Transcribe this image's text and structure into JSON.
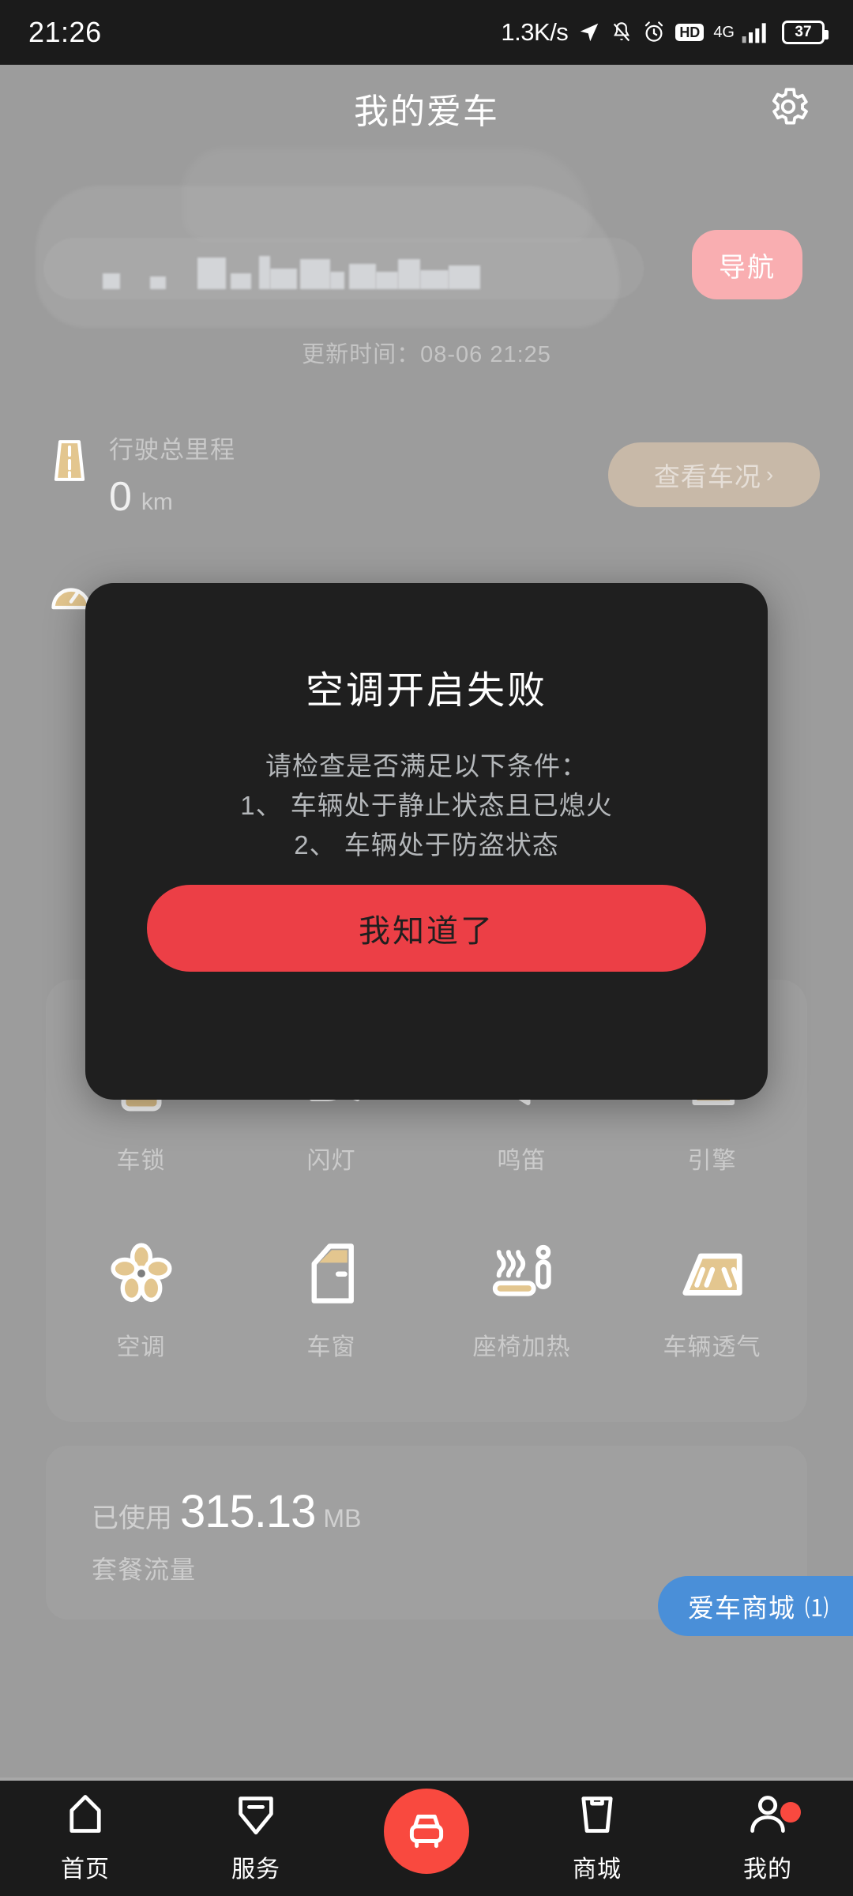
{
  "status_bar": {
    "time": "21:26",
    "network_speed": "1.3K/s",
    "hd_label": "HD",
    "network_type": "4G",
    "battery_percent": "37",
    "icons": [
      "location-arrow-icon",
      "bell-muted-icon",
      "alarm-clock-icon",
      "hd-icon",
      "signal-bars-icon",
      "battery-icon"
    ]
  },
  "header": {
    "title": "我的爱车",
    "settings_icon": "gear-icon"
  },
  "car_info": {
    "location_redacted": true,
    "nav_button_label": "导航",
    "update_time": "更新时间：08-06 21:25"
  },
  "mileage": {
    "label": "行驶总里程",
    "value": "0",
    "unit": "km",
    "road_icon": "road-icon",
    "status_button_label": "查看车况",
    "status_button_chevron": "›"
  },
  "controls": {
    "row1": [
      {
        "label": "车锁",
        "icon": "car-lock-icon"
      },
      {
        "label": "闪灯",
        "icon": "headlight-flash-icon"
      },
      {
        "label": "鸣笛",
        "icon": "horn-icon"
      },
      {
        "label": "引擎",
        "icon": "engine-icon"
      }
    ],
    "row2": [
      {
        "label": "空调",
        "icon": "fan-icon"
      },
      {
        "label": "车窗",
        "icon": "car-door-window-icon"
      },
      {
        "label": "座椅加热",
        "icon": "seat-heating-icon"
      },
      {
        "label": "车辆透气",
        "icon": "windshield-vent-icon"
      }
    ]
  },
  "data_usage": {
    "prefix": "已使用",
    "amount": "315.13",
    "unit": "MB",
    "subtitle": "套餐流量"
  },
  "shop_tab": {
    "label": "爱车商城",
    "glyph": "⑴"
  },
  "modal": {
    "title": "空调开启失败",
    "line1": "请检查是否满足以下条件：",
    "line2": "1、 车辆处于静止状态且已熄火",
    "line3": "2、 车辆处于防盗状态",
    "confirm_label": "我知道了"
  },
  "bottom_nav": {
    "items": [
      {
        "label": "首页",
        "icon": "home-icon"
      },
      {
        "label": "服务",
        "icon": "service-tag-icon"
      },
      {
        "label": "",
        "icon": "car-icon"
      },
      {
        "label": "商城",
        "icon": "shop-bag-icon"
      },
      {
        "label": "我的",
        "icon": "person-icon",
        "badge": true
      }
    ]
  },
  "colors": {
    "page_background": "#9c9c9c",
    "status_bar": "#1b1b1b",
    "modal_background": "#1f1f1f",
    "modal_button": "#ec3f46",
    "nav_accent": "#f9493f",
    "nav_pill": "#f9aeb1",
    "shop_tab": "#4a8fd8",
    "icon_accent": "#e3c68f"
  }
}
